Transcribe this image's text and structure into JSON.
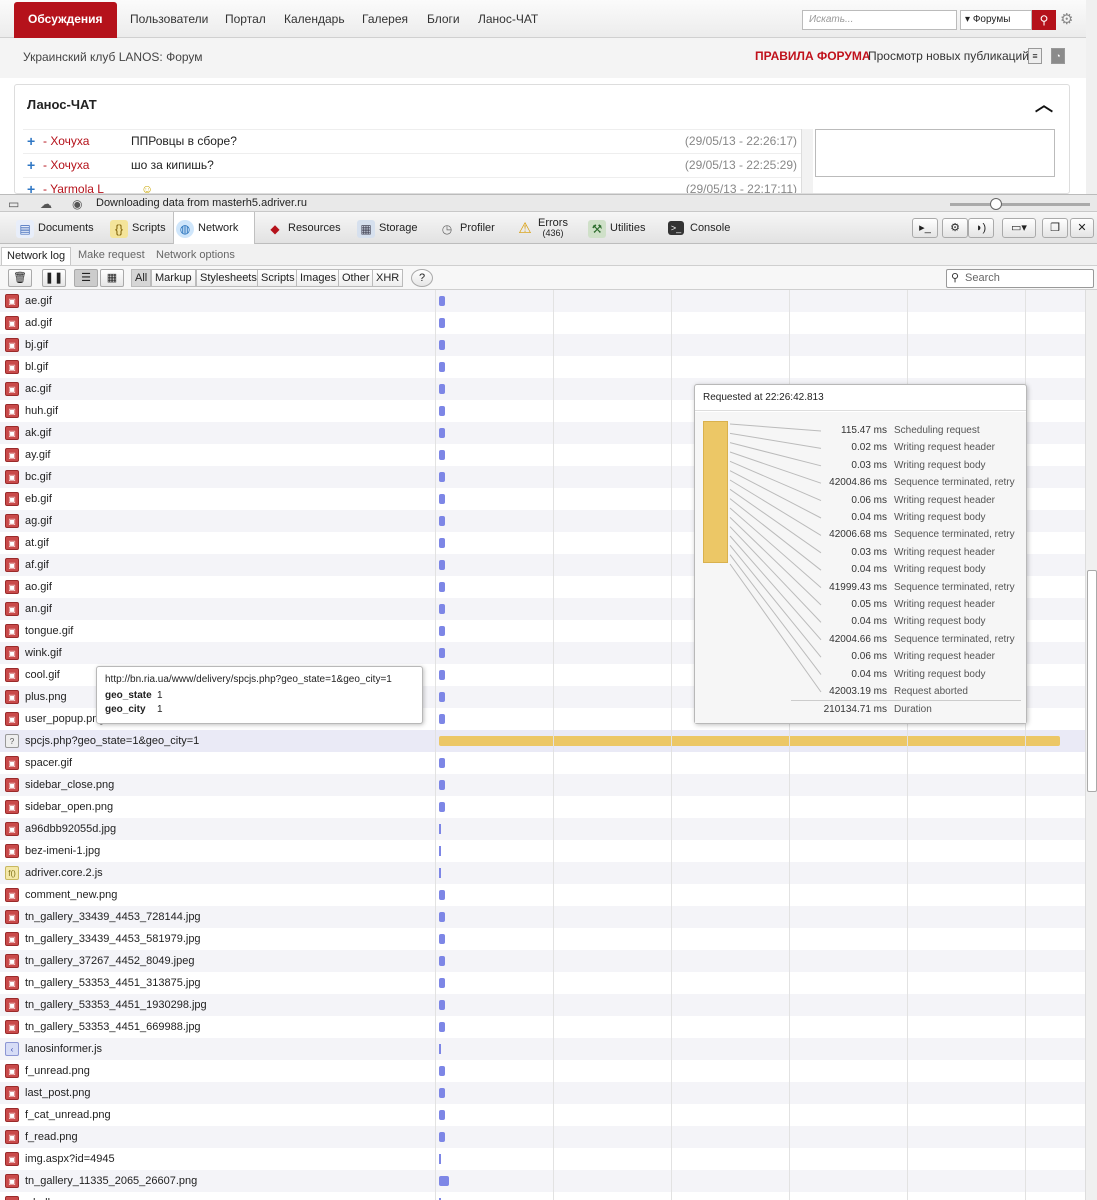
{
  "forum": {
    "nav": [
      "Обсуждения",
      "Пользователи",
      "Портал",
      "Календарь",
      "Галерея",
      "Блоги",
      "Ланос-ЧАТ"
    ],
    "search_placeholder": "Искать...",
    "search_scope": "Форумы",
    "club_title": "Украинский клуб LANOS: Форум",
    "rules": "ПРАВИЛА ФОРУМА",
    "new_posts": "Просмотр новых публикаций",
    "chat": {
      "title": "Ланос-ЧАТ",
      "rows": [
        {
          "user": "- Хочуха",
          "msg": "ППРовцы в сборе?",
          "time": "(29/05/13 - 22:26:17)"
        },
        {
          "user": "- Хочуха",
          "msg": "шо за кипишь?",
          "time": "(29/05/13 - 22:25:29)"
        },
        {
          "user": "- Yarmola L",
          "msg": "",
          "time": "(29/05/13 - 22:17:11)"
        }
      ]
    }
  },
  "status": {
    "text": "Downloading data from masterh5.adriver.ru"
  },
  "devtools": {
    "tabs": [
      "Documents",
      "Scripts",
      "Network",
      "Resources",
      "Storage",
      "Profiler",
      "Errors",
      "Utilities",
      "Console"
    ],
    "errors_count": "(436)",
    "active_tab": "Network",
    "subtabs": [
      "Network log",
      "Make request",
      "Network options"
    ],
    "filters": [
      "All",
      "Markup",
      "Stylesheets",
      "Scripts",
      "Images",
      "Other",
      "XHR"
    ],
    "search_placeholder": "Search"
  },
  "network": {
    "files": [
      {
        "name": "ae.gif",
        "type": "img",
        "bar": "small"
      },
      {
        "name": "ad.gif",
        "type": "img",
        "bar": "small"
      },
      {
        "name": "bj.gif",
        "type": "img",
        "bar": "small"
      },
      {
        "name": "bl.gif",
        "type": "img",
        "bar": "small"
      },
      {
        "name": "ac.gif",
        "type": "img",
        "bar": "small"
      },
      {
        "name": "huh.gif",
        "type": "img",
        "bar": "small"
      },
      {
        "name": "ak.gif",
        "type": "img",
        "bar": "small"
      },
      {
        "name": "ay.gif",
        "type": "img",
        "bar": "small"
      },
      {
        "name": "bc.gif",
        "type": "img",
        "bar": "small"
      },
      {
        "name": "eb.gif",
        "type": "img",
        "bar": "small"
      },
      {
        "name": "ag.gif",
        "type": "img",
        "bar": "small"
      },
      {
        "name": "at.gif",
        "type": "img",
        "bar": "small"
      },
      {
        "name": "af.gif",
        "type": "img",
        "bar": "small"
      },
      {
        "name": "ao.gif",
        "type": "img",
        "bar": "small"
      },
      {
        "name": "an.gif",
        "type": "img",
        "bar": "small"
      },
      {
        "name": "tongue.gif",
        "type": "img",
        "bar": "small"
      },
      {
        "name": "wink.gif",
        "type": "img",
        "bar": "small"
      },
      {
        "name": "cool.gif",
        "type": "img",
        "bar": "small"
      },
      {
        "name": "plus.png",
        "type": "img",
        "bar": "small"
      },
      {
        "name": "user_popup.png",
        "type": "img",
        "bar": "small"
      },
      {
        "name": "spcjs.php?geo_state=1&geo_city=1",
        "type": "unk",
        "bar": "long"
      },
      {
        "name": "spacer.gif",
        "type": "img",
        "bar": "small"
      },
      {
        "name": "sidebar_close.png",
        "type": "img",
        "bar": "small"
      },
      {
        "name": "sidebar_open.png",
        "type": "img",
        "bar": "small"
      },
      {
        "name": "a96dbb92055d.jpg",
        "type": "img",
        "bar": "thin"
      },
      {
        "name": "bez-imeni-1.jpg",
        "type": "img",
        "bar": "thin"
      },
      {
        "name": "adriver.core.2.js",
        "type": "js",
        "bar": "thin"
      },
      {
        "name": "comment_new.png",
        "type": "img",
        "bar": "small"
      },
      {
        "name": "tn_gallery_33439_4453_728144.jpg",
        "type": "img",
        "bar": "small"
      },
      {
        "name": "tn_gallery_33439_4453_581979.jpg",
        "type": "img",
        "bar": "small"
      },
      {
        "name": "tn_gallery_37267_4452_8049.jpeg",
        "type": "img",
        "bar": "small"
      },
      {
        "name": "tn_gallery_53353_4451_313875.jpg",
        "type": "img",
        "bar": "small"
      },
      {
        "name": "tn_gallery_53353_4451_1930298.jpg",
        "type": "img",
        "bar": "small"
      },
      {
        "name": "tn_gallery_53353_4451_669988.jpg",
        "type": "img",
        "bar": "small"
      },
      {
        "name": "lanosinformer.js",
        "type": "js2",
        "bar": "thin"
      },
      {
        "name": "f_unread.png",
        "type": "img",
        "bar": "small"
      },
      {
        "name": "last_post.png",
        "type": "img",
        "bar": "small"
      },
      {
        "name": "f_cat_unread.png",
        "type": "img",
        "bar": "small"
      },
      {
        "name": "f_read.png",
        "type": "img",
        "bar": "small"
      },
      {
        "name": "img.aspx?id=4945",
        "type": "img",
        "bar": "thin"
      },
      {
        "name": "tn_gallery_11335_2065_26607.png",
        "type": "img",
        "bar": "wide"
      },
      {
        "name": "whalkn.png",
        "type": "img",
        "bar": "thin"
      }
    ],
    "url_tooltip": {
      "url": "http://bn.ria.ua/www/delivery/spcjs.php?geo_state=1&geo_city=1",
      "params": [
        {
          "name": "geo_state",
          "value": "1"
        },
        {
          "name": "geo_city",
          "value": "1"
        }
      ]
    },
    "timing": {
      "requested": "Requested at 22:26:42.813",
      "rows": [
        {
          "ms": "115.47 ms",
          "label": "Scheduling request"
        },
        {
          "ms": "0.02 ms",
          "label": "Writing request header"
        },
        {
          "ms": "0.03 ms",
          "label": "Writing request body"
        },
        {
          "ms": "42004.86 ms",
          "label": "Sequence terminated, retry"
        },
        {
          "ms": "0.06 ms",
          "label": "Writing request header"
        },
        {
          "ms": "0.04 ms",
          "label": "Writing request body"
        },
        {
          "ms": "42006.68 ms",
          "label": "Sequence terminated, retry"
        },
        {
          "ms": "0.03 ms",
          "label": "Writing request header"
        },
        {
          "ms": "0.04 ms",
          "label": "Writing request body"
        },
        {
          "ms": "41999.43 ms",
          "label": "Sequence terminated, retry"
        },
        {
          "ms": "0.05 ms",
          "label": "Writing request header"
        },
        {
          "ms": "0.04 ms",
          "label": "Writing request body"
        },
        {
          "ms": "42004.66 ms",
          "label": "Sequence terminated, retry"
        },
        {
          "ms": "0.06 ms",
          "label": "Writing request header"
        },
        {
          "ms": "0.04 ms",
          "label": "Writing request body"
        },
        {
          "ms": "42003.19 ms",
          "label": "Request aborted"
        }
      ],
      "duration_ms": "210134.71 ms",
      "duration_label": "Duration"
    }
  }
}
